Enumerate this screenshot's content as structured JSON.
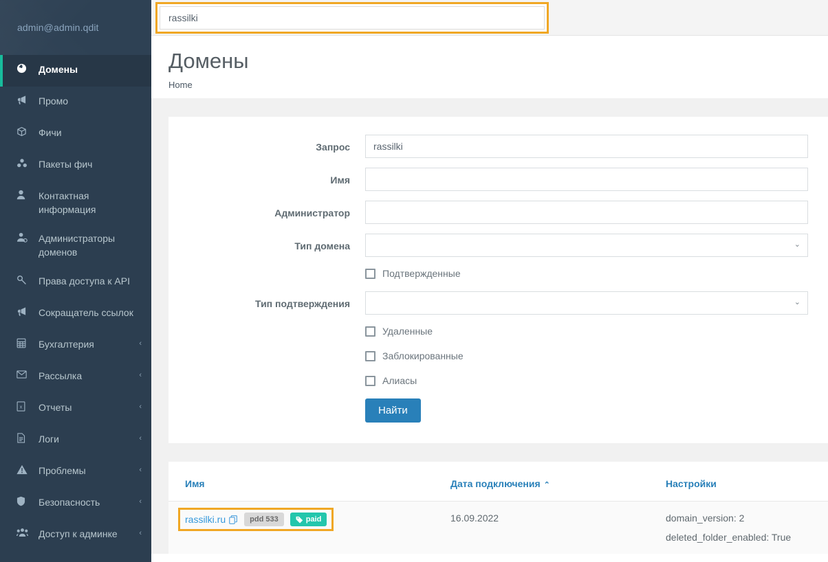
{
  "sidebar": {
    "user_email": "admin@admin.qdit",
    "accent_active": "#18bc9c",
    "background": "#2c3e50",
    "items": [
      {
        "label": "Домены",
        "icon": "globe-icon",
        "active": true,
        "caret": ""
      },
      {
        "label": "Промо",
        "icon": "bullhorn-icon",
        "active": false,
        "caret": ""
      },
      {
        "label": "Фичи",
        "icon": "cube-icon",
        "active": false,
        "caret": ""
      },
      {
        "label": "Пакеты фич",
        "icon": "cubes-icon",
        "active": false,
        "caret": ""
      },
      {
        "label": "Контактная информация",
        "icon": "user-icon",
        "active": false,
        "caret": ""
      },
      {
        "label": "Администраторы доменов",
        "icon": "user-gear-icon",
        "active": false,
        "caret": ""
      },
      {
        "label": "Права доступа к API",
        "icon": "key-icon",
        "active": false,
        "caret": ""
      },
      {
        "label": "Сокращатель ссылок",
        "icon": "bullhorn-icon",
        "active": false,
        "caret": ""
      },
      {
        "label": "Бухгалтерия",
        "icon": "calculator-icon",
        "active": false,
        "caret": "‹"
      },
      {
        "label": "Рассылка",
        "icon": "envelope-icon",
        "active": false,
        "caret": "‹"
      },
      {
        "label": "Отчеты",
        "icon": "excel-file-icon",
        "active": false,
        "caret": "‹"
      },
      {
        "label": "Логи",
        "icon": "file-text-icon",
        "active": false,
        "caret": "‹"
      },
      {
        "label": "Проблемы",
        "icon": "warning-icon",
        "active": false,
        "caret": "‹"
      },
      {
        "label": "Безопасность",
        "icon": "shield-icon",
        "active": false,
        "caret": "‹"
      },
      {
        "label": "Доступ к админке",
        "icon": "users-icon",
        "active": false,
        "caret": "‹"
      }
    ]
  },
  "topbar": {
    "search_value": "rassilki",
    "search_placeholder": "",
    "highlight_color": "#f0a724"
  },
  "page": {
    "title": "Домены",
    "breadcrumb": "Home"
  },
  "form": {
    "fields": [
      {
        "label": "Запрос",
        "value": "rassilki",
        "type": "text",
        "name": "query-field"
      },
      {
        "label": "Имя",
        "value": "",
        "type": "text",
        "name": "name-field"
      },
      {
        "label": "Администратор",
        "value": "",
        "type": "text",
        "name": "admin-field"
      },
      {
        "label": "Тип домена",
        "value": "",
        "type": "select",
        "name": "domain-type-select"
      }
    ],
    "checkbox_confirmed": {
      "label": "Подтвержденные",
      "checked": false
    },
    "confirm_type": {
      "label": "Тип подтверждения",
      "value": "",
      "type": "select"
    },
    "checkboxes": [
      {
        "label": "Удаленные",
        "checked": false,
        "name": "deleted-checkbox"
      },
      {
        "label": "Заблокированные",
        "checked": false,
        "name": "blocked-checkbox"
      },
      {
        "label": "Алиасы",
        "checked": false,
        "name": "aliases-checkbox"
      }
    ],
    "submit_label": "Найти",
    "submit_color": "#2980b9"
  },
  "table": {
    "columns": [
      {
        "label": "Имя",
        "sorted": false,
        "sort_caret": ""
      },
      {
        "label": "Дата подключения",
        "sorted": true,
        "sort_caret": "⌃"
      },
      {
        "label": "Настройки",
        "sorted": false,
        "sort_caret": ""
      }
    ],
    "rows": [
      {
        "domain": "rassilki.ru",
        "copy_icon": "copy-icon",
        "tags": [
          {
            "text": "pdd 533",
            "style": "grey",
            "icon": ""
          },
          {
            "text": "paid",
            "style": "teal",
            "icon": "tag-icon"
          }
        ],
        "date": "16.09.2022",
        "settings": [
          "domain_version: 2",
          "deleted_folder_enabled: True"
        ]
      }
    ]
  }
}
